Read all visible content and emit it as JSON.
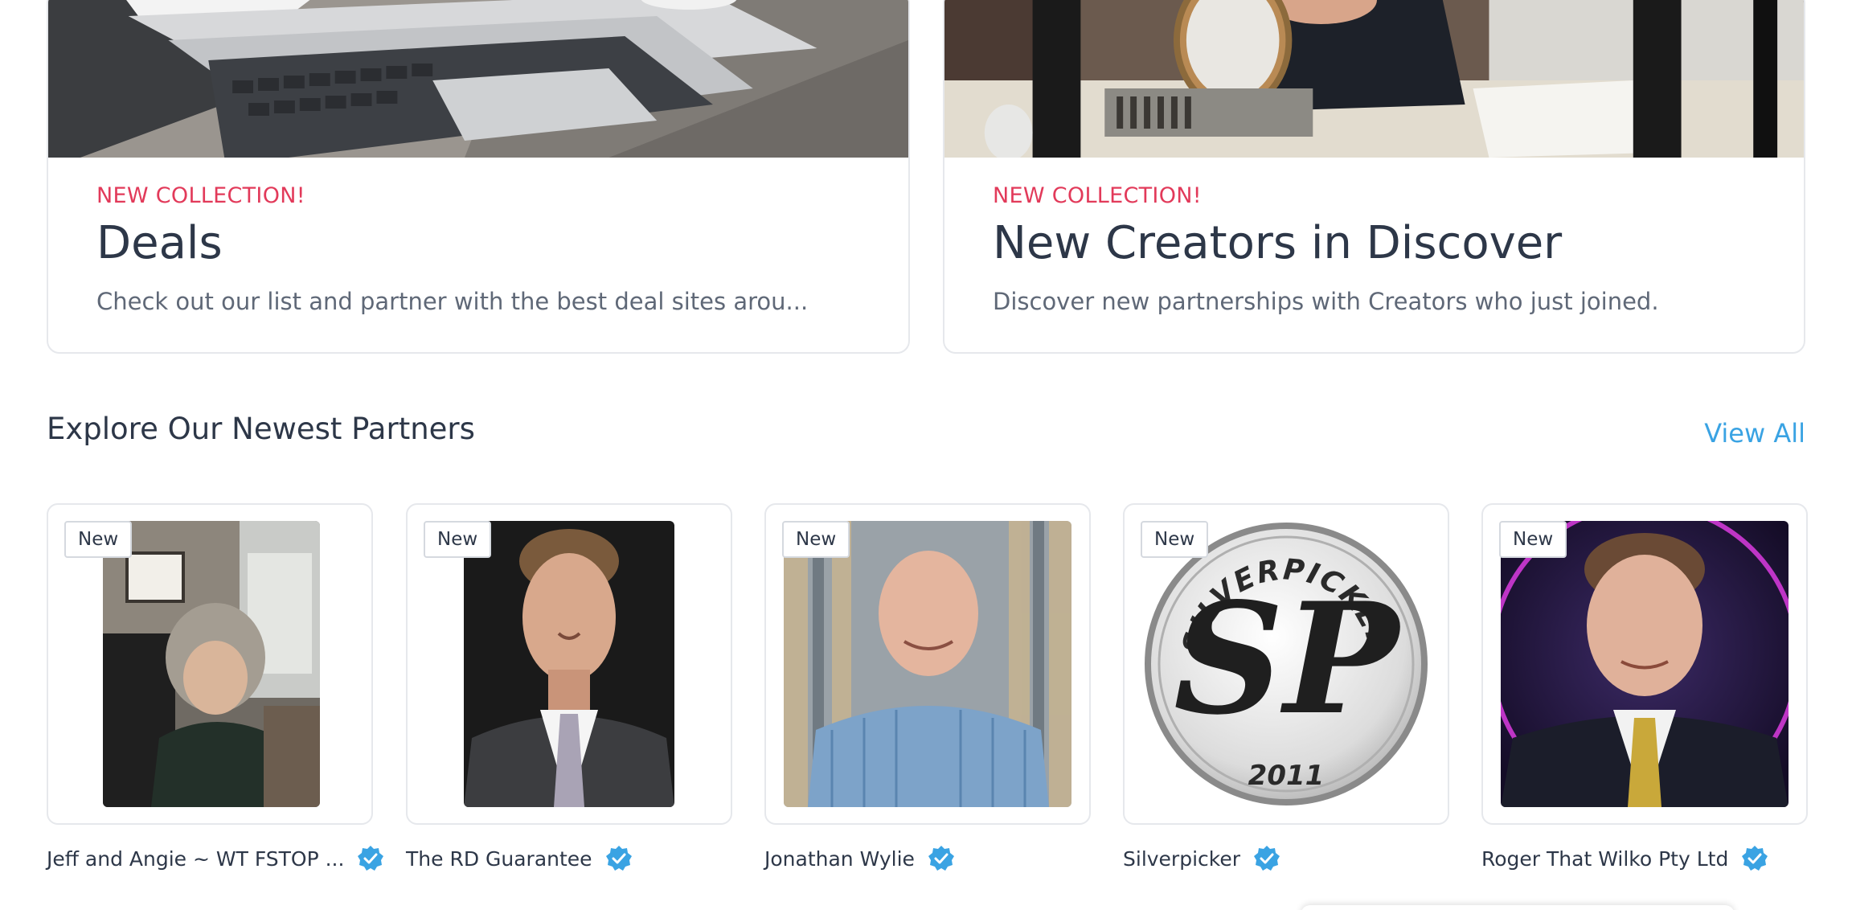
{
  "collections": [
    {
      "kicker": "NEW COLLECTION!",
      "title": "Deals",
      "description": "Check out our list and partner with the best deal sites arou..."
    },
    {
      "kicker": "NEW COLLECTION!",
      "title": "New Creators in Discover",
      "description": "Discover new partnerships with Creators who just joined."
    }
  ],
  "partners_section": {
    "title": "Explore Our Newest Partners",
    "view_all_label": "View All"
  },
  "partners": [
    {
      "badge": "New",
      "name": "Jeff and Angie ~ WT FSTOP ...",
      "verified": true
    },
    {
      "badge": "New",
      "name": "The RD Guarantee",
      "verified": true
    },
    {
      "badge": "New",
      "name": "Jonathan Wylie",
      "verified": true
    },
    {
      "badge": "New",
      "name": "Silverpicker",
      "verified": true
    },
    {
      "badge": "New",
      "name": "Roger That Wilko Pty Ltd",
      "verified": true
    }
  ],
  "logo_text": {
    "silverpicker_arc": "SILVERPICKER",
    "silverpicker_year": "2011",
    "silverpicker_mark": "SP"
  },
  "colors": {
    "accent_link": "#3aa3e3",
    "kicker": "#e23a5a",
    "verified": "#3aa3e3",
    "text": "#2d3748"
  }
}
